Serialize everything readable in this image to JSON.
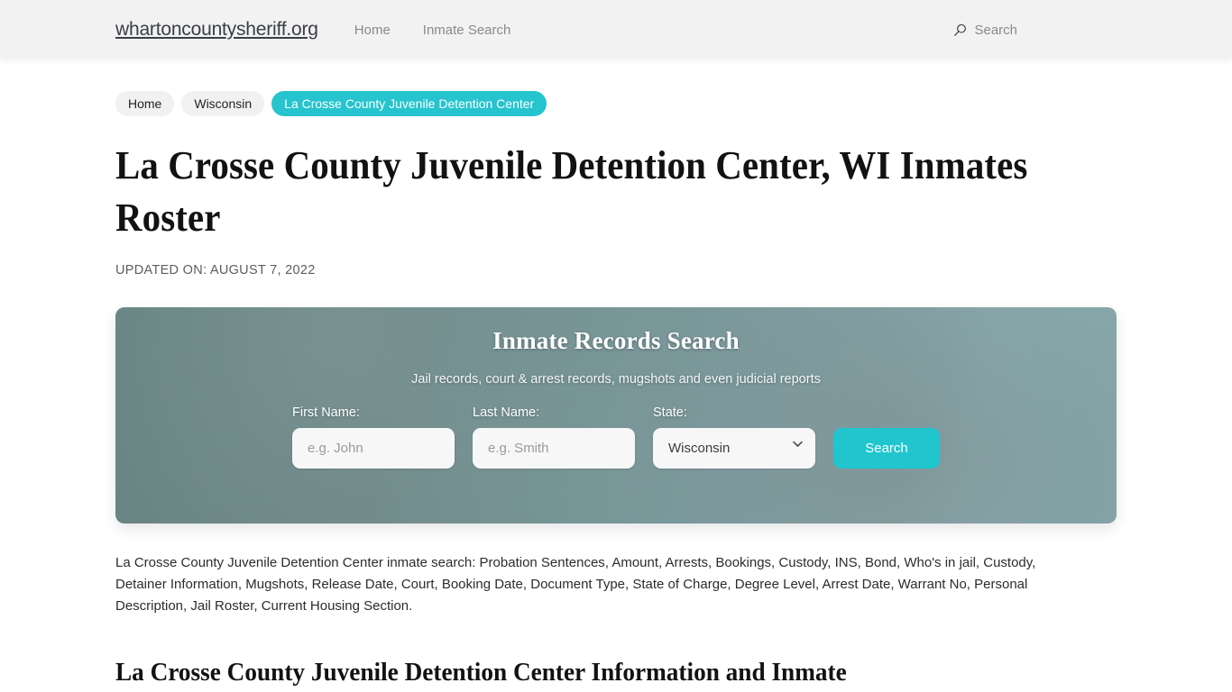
{
  "header": {
    "brand": "whartoncountysheriff.org",
    "nav": [
      {
        "label": "Home"
      },
      {
        "label": "Inmate Search"
      }
    ],
    "search_label": "Search",
    "search_icon": "search-icon"
  },
  "breadcrumb": [
    {
      "label": "Home",
      "active": false
    },
    {
      "label": "Wisconsin",
      "active": false
    },
    {
      "label": "La Crosse County Juvenile Detention Center",
      "active": true
    }
  ],
  "main": {
    "title": "La Crosse County Juvenile Detention Center, WI Inmates Roster",
    "updated_on": "UPDATED ON: AUGUST 7, 2022",
    "intro_copy": "La Crosse County Juvenile Detention Center inmate search: Probation Sentences, Amount, Arrests, Bookings, Custody, INS, Bond, Who's in jail, Custody, Detainer Information, Mugshots, Release Date, Court, Booking Date, Document Type, State of Charge, Degree Level, Arrest Date, Warrant No, Personal Description, Jail Roster, Current Housing Section.",
    "section_heading": "La Crosse County Juvenile Detention Center Information and Inmate"
  },
  "search_panel": {
    "title": "Inmate Records Search",
    "subtitle": "Jail records, court & arrest records, mugshots and even judicial reports",
    "first_name": {
      "label": "First Name:",
      "placeholder": "e.g. John",
      "value": ""
    },
    "last_name": {
      "label": "Last Name:",
      "placeholder": "e.g. Smith",
      "value": ""
    },
    "state": {
      "label": "State:",
      "selected": "Wisconsin",
      "options": [
        "Wisconsin"
      ]
    },
    "submit_label": "Search"
  },
  "colors": {
    "accent_teal": "#21c5ce",
    "breadcrumb_active": "#25c4ce",
    "header_bg": "#f2f2f2",
    "panel_gradient_left": "#63807e",
    "panel_gradient_right": "#8cb0b3",
    "pill_bg": "#f1f1f1",
    "input_bg": "#f7f7f7"
  }
}
